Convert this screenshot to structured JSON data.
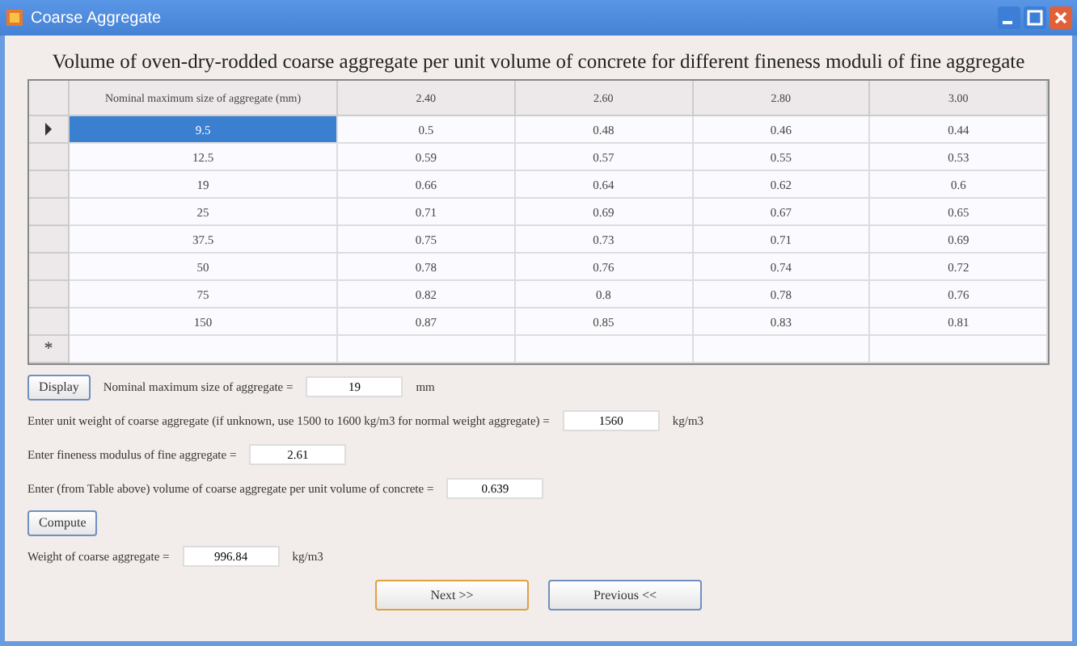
{
  "window": {
    "title": "Coarse Aggregate"
  },
  "heading": "Volume of oven-dry-rodded coarse aggregate per unit volume of concrete for different fineness moduli of fine aggregate",
  "table": {
    "columns": [
      "Nominal maximum size of aggregate (mm)",
      "2.40",
      "2.60",
      "2.80",
      "3.00"
    ],
    "rows": [
      {
        "cells": [
          "9.5",
          "0.5",
          "0.48",
          "0.46",
          "0.44"
        ],
        "current": true,
        "selected": true
      },
      {
        "cells": [
          "12.5",
          "0.59",
          "0.57",
          "0.55",
          "0.53"
        ],
        "current": false,
        "selected": false
      },
      {
        "cells": [
          "19",
          "0.66",
          "0.64",
          "0.62",
          "0.6"
        ],
        "current": false,
        "selected": false
      },
      {
        "cells": [
          "25",
          "0.71",
          "0.69",
          "0.67",
          "0.65"
        ],
        "current": false,
        "selected": false
      },
      {
        "cells": [
          "37.5",
          "0.75",
          "0.73",
          "0.71",
          "0.69"
        ],
        "current": false,
        "selected": false
      },
      {
        "cells": [
          "50",
          "0.78",
          "0.76",
          "0.74",
          "0.72"
        ],
        "current": false,
        "selected": false
      },
      {
        "cells": [
          "75",
          "0.82",
          "0.8",
          "0.78",
          "0.76"
        ],
        "current": false,
        "selected": false
      },
      {
        "cells": [
          "150",
          "0.87",
          "0.85",
          "0.83",
          "0.81"
        ],
        "current": false,
        "selected": false
      }
    ],
    "new_row_marker": "*"
  },
  "form": [
    {
      "kind": "button-field",
      "button": "Display",
      "label": "Nominal maximum size of aggregate =",
      "value": "19",
      "unit": "mm"
    },
    {
      "kind": "field",
      "label": "Enter unit weight of coarse aggregate (if unknown, use 1500 to 1600 kg/m3 for normal weight aggregate) =",
      "value": "1560",
      "unit": "kg/m3"
    },
    {
      "kind": "field",
      "label": "Enter fineness modulus of fine aggregate =",
      "value": "2.61"
    },
    {
      "kind": "field",
      "label": "Enter (from Table above) volume of coarse aggregate per unit volume of concrete =",
      "value": "0.639"
    },
    {
      "kind": "button",
      "button": "Compute"
    },
    {
      "kind": "field",
      "label": "Weight of coarse aggregate =",
      "value": "996.84",
      "unit": "kg/m3"
    }
  ],
  "buttons": [
    {
      "label": "Next >>",
      "focused": true
    },
    {
      "label": "Previous <<",
      "focused": false
    }
  ]
}
